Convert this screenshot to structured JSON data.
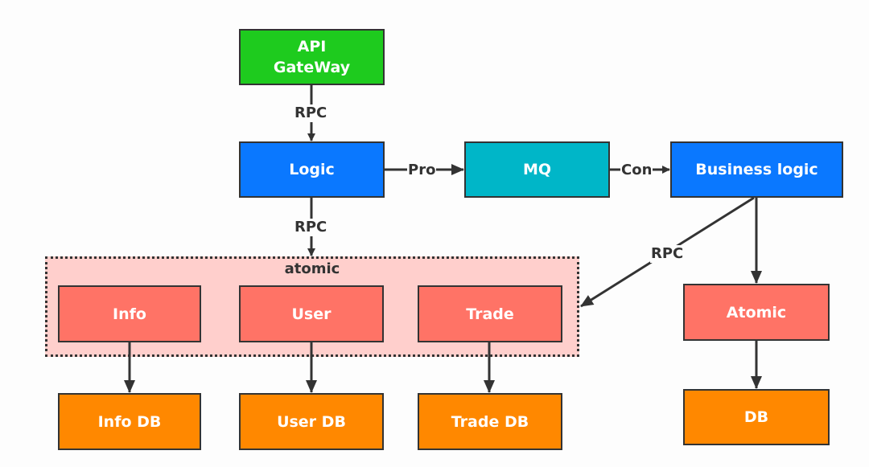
{
  "nodes": {
    "api_gateway": "API\nGateWay",
    "api_line1": "API",
    "api_line2": "GateWay",
    "logic": "Logic",
    "mq": "MQ",
    "business_logic": "Business logic",
    "atomic_group": "atomic",
    "info": "Info",
    "user": "User",
    "trade": "Trade",
    "atomic": "Atomic",
    "info_db": "Info DB",
    "user_db": "User DB",
    "trade_db": "Trade DB",
    "db": "DB"
  },
  "edges": {
    "gateway_logic": "RPC",
    "logic_atomic": "RPC",
    "logic_mq": "Pro",
    "mq_business": "Con",
    "business_atomic_group": "RPC"
  },
  "colors": {
    "gateway": "#1ecb1e",
    "logic": "#0a78ff",
    "mq": "#00b6c8",
    "atomic": "#ff7366",
    "db": "#ff8800",
    "group": "#ffcfcc"
  }
}
